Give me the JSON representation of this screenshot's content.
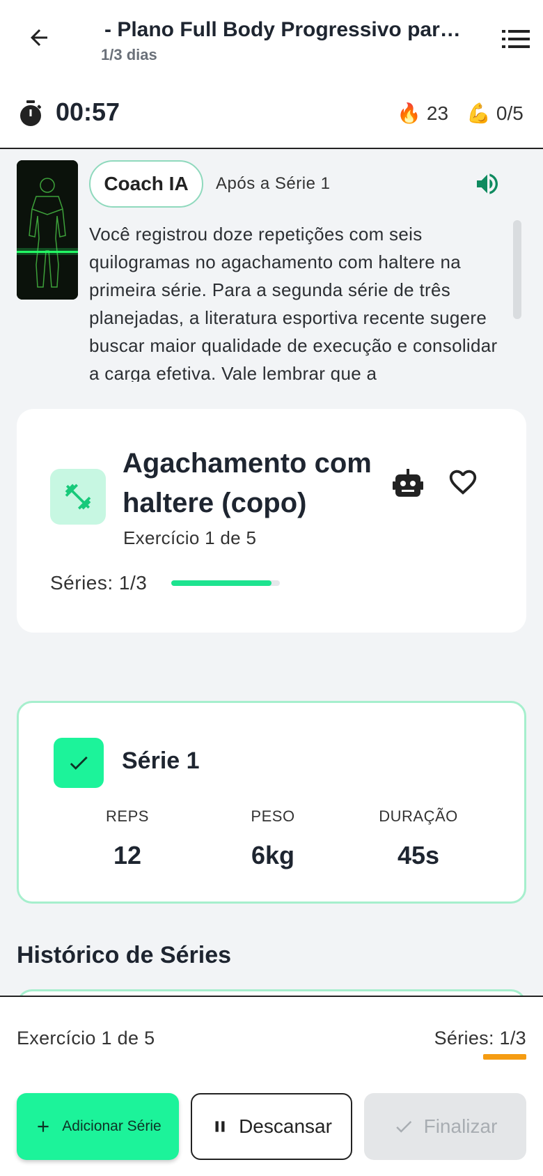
{
  "header": {
    "title": "- Plano Full Body Progressivo para ...",
    "subtitle": "1/3 dias",
    "back_icon": "arrow-left-icon",
    "menu_icon": "list-icon"
  },
  "status": {
    "timer": "00:57",
    "fire_emoji": "🔥",
    "fire_count": "23",
    "muscle_emoji": "💪",
    "muscle_count": "0/5"
  },
  "coach": {
    "badge": "Coach IA",
    "after_label": "Após a Série 1",
    "text": "Você registrou doze repetições com seis quilogramas no agachamento com haltere na primeira série. Para a segunda série de três planejadas, a literatura esportiva recente sugere buscar maior qualidade de execução e consolidar a carga efetiva. Vale lembrar que a",
    "speaker_icon": "volume-icon",
    "accent": "#0f8a5f"
  },
  "exercise": {
    "name": "Agachamento com haltere (copo)",
    "count": "Exercício 1 de 5",
    "series_label": "Séries: 1/3",
    "series_progress": 0.92
  },
  "current_set": {
    "title": "Série 1",
    "completed": true,
    "columns": [
      {
        "label": "REPS",
        "value": "12"
      },
      {
        "label": "PESO",
        "value": "6kg"
      },
      {
        "label": "DURAÇÃO",
        "value": "45s"
      }
    ]
  },
  "history": {
    "title": "Histórico de Séries"
  },
  "bottom": {
    "exercise_count": "Exercício 1 de 5",
    "series": "Séries: 1/3",
    "add_label": "Adicionar Série",
    "rest_label": "Descansar",
    "finish_label": "Finalizar"
  },
  "colors": {
    "primary": "#1cf39a",
    "progress": "#1de38f",
    "orange": "#f59c12"
  }
}
